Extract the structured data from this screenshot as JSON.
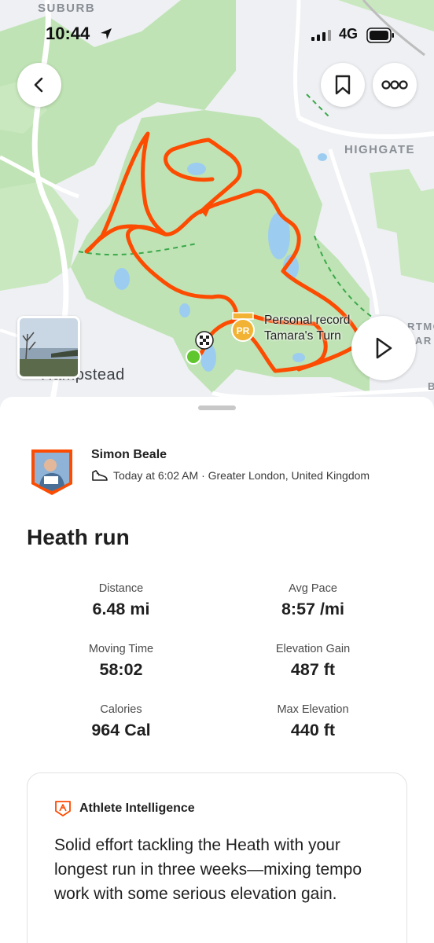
{
  "status_bar": {
    "time": "10:44",
    "network": "4G"
  },
  "map": {
    "labels": {
      "suburb": "SUBURB",
      "highgate": "HIGHGATE",
      "hampstead": "Hampstead",
      "edge_right_1": "RTMO",
      "edge_right_2": "AR",
      "edge_right_3": "B"
    },
    "route_color": "#fc4c02",
    "park_color": "#bfe3b4"
  },
  "personal_record": {
    "badge": "PR",
    "line1": "Personal record",
    "line2": "Tamara's Turn"
  },
  "icons": {
    "back": "chevron-left-icon",
    "bookmark": "bookmark-icon",
    "more": "more-dots-icon",
    "play": "play-icon",
    "shoe": "shoe-icon",
    "ai": "athlete-intelligence-icon"
  },
  "athlete": {
    "name": "Simon Beale",
    "meta": "Today at 6:02 AM · Greater London, United Kingdom"
  },
  "activity": {
    "title": "Heath run"
  },
  "stats": [
    {
      "label": "Distance",
      "value": "6.48 mi"
    },
    {
      "label": "Avg Pace",
      "value": "8:57 /mi"
    },
    {
      "label": "Moving Time",
      "value": "58:02"
    },
    {
      "label": "Elevation Gain",
      "value": "487 ft"
    },
    {
      "label": "Calories",
      "value": "964 Cal"
    },
    {
      "label": "Max Elevation",
      "value": "440 ft"
    }
  ],
  "athlete_intelligence": {
    "title": "Athlete Intelligence",
    "body": "Solid effort tackling the Heath with your longest run in three weeks—mixing tempo work with some serious elevation gain."
  },
  "colors": {
    "brand": "#fc4c02",
    "start": "#5fc62d",
    "pr_gold": "#f2b233"
  }
}
